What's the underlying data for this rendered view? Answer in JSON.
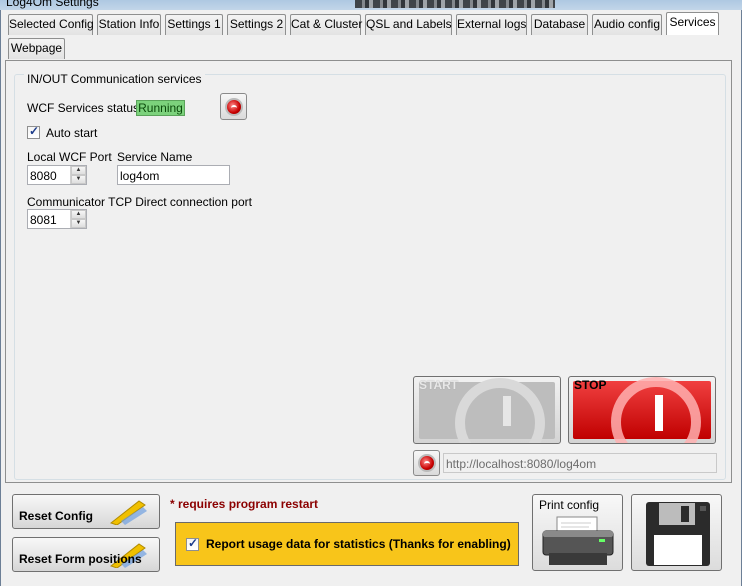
{
  "window": {
    "title": "Log4Om Settings"
  },
  "tabs": {
    "row1": [
      "Selected Config",
      "Station Info",
      "Settings 1",
      "Settings 2",
      "Cat & Cluster",
      "QSL and Labels",
      "External logs",
      "Database",
      "Audio config",
      "Services"
    ],
    "row2": [
      "Webpage"
    ],
    "active": "Services"
  },
  "group": {
    "title": "IN/OUT Communication services",
    "wcf_status_label": "WCF Services status",
    "wcf_status_value": "Running",
    "auto_start_label": "Auto start",
    "auto_start_checked": true,
    "local_port_label": "Local WCF Port",
    "local_port_value": "8080",
    "service_name_label": "Service Name",
    "service_name_value": "log4om",
    "tcp_port_label": "Communicator TCP Direct connection port",
    "tcp_port_value": "8081",
    "start_label": "START",
    "stop_label": "STOP",
    "url_value": "http://localhost:8080/log4om"
  },
  "footer": {
    "reset_config_label": "Reset Config",
    "reset_positions_label": "Reset Form positions",
    "restart_note": "* requires program restart",
    "usage_label": "Report usage data for statistics (Thanks for enabling)",
    "usage_checked": true,
    "print_label": "Print config"
  },
  "colors": {
    "running_bg": "#7cd27c",
    "usage_bg": "#f8c51a",
    "restart_note": "#8b0000",
    "stop_red": "#d01010"
  },
  "icons": {
    "refresh": "refresh-icon",
    "printer": "printer-icon",
    "save": "floppy-disk-icon",
    "wand": "magic-wand-icon"
  }
}
